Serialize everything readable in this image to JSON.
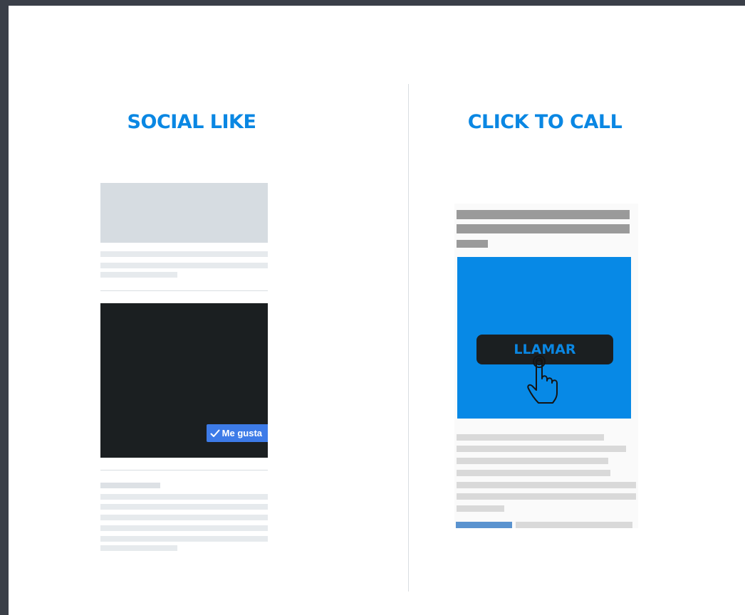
{
  "left_section": {
    "title": "SOCIAL LIKE",
    "like_button_label": "Me gusta"
  },
  "right_section": {
    "title": "CLICK TO CALL",
    "call_button_label": "LLAMAR"
  },
  "icons": {
    "like": "check-icon",
    "call": "pointing-hand-icon"
  },
  "colors": {
    "accent": "#0a87e3",
    "ad_background": "#0789e6",
    "like_button": "#3d7be8",
    "dark": "#1b1f21"
  }
}
